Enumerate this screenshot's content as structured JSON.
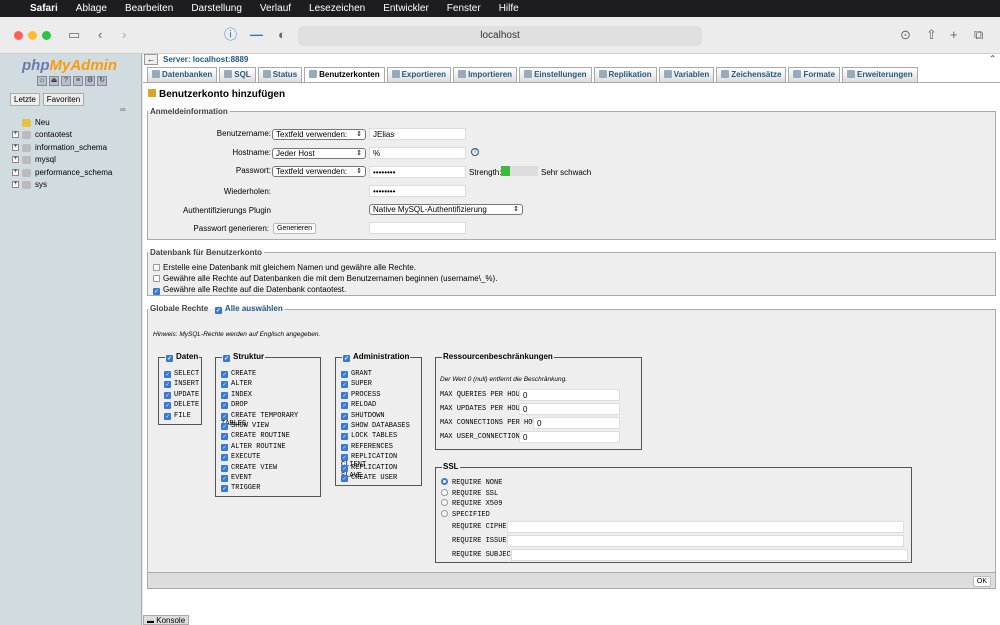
{
  "menubar": {
    "app": "Safari",
    "items": [
      "Ablage",
      "Bearbeiten",
      "Darstellung",
      "Verlauf",
      "Lesezeichen",
      "Entwickler",
      "Fenster",
      "Hilfe"
    ]
  },
  "browser": {
    "url": "localhost"
  },
  "sidebar": {
    "logo_php": "php",
    "logo_my": "MyAdmin",
    "tab_recent": "Letzte",
    "tab_favorites": "Favoriten",
    "tree": [
      "Neu",
      "contaotest",
      "information_schema",
      "mysql",
      "performance_schema",
      "sys"
    ]
  },
  "server": "Server: localhost:8889",
  "tabs": [
    "Datenbanken",
    "SQL",
    "Status",
    "Benutzerkonten",
    "Exportieren",
    "Importieren",
    "Einstellungen",
    "Replikation",
    "Variablen",
    "Zeichensätze",
    "Formate",
    "Erweiterungen"
  ],
  "page_title": "Benutzerkonto hinzufügen",
  "login": {
    "legend": "Anmeldeinformation",
    "username_label": "Benutzername:",
    "username_select": "Textfeld verwenden:",
    "username_value": "JElias",
    "host_label": "Hostname:",
    "host_select": "Jeder Host",
    "host_value": "%",
    "host_help": "?",
    "password_label": "Passwort:",
    "password_select": "Textfeld verwenden:",
    "password_value": "••••••••",
    "strength_label": "Strength:",
    "strength_text": "Sehr schwach",
    "strength_fraction": 0.25,
    "repeat_label": "Wiederholen:",
    "repeat_value": "••••••••",
    "plugin_label": "Authentifizierungs Plugin",
    "plugin_value": "Native MySQL-Authentifizierung",
    "generate_label": "Passwort generieren:",
    "generate_button": "Generieren"
  },
  "database": {
    "legend": "Datenbank für Benutzerkonto",
    "options": [
      {
        "label": "Erstelle eine Datenbank mit gleichem Namen und gewähre alle Rechte.",
        "checked": false
      },
      {
        "label": "Gewähre alle Rechte auf Datenbanken die mit dem Benutzernamen beginnen (username\\_%).",
        "checked": false
      },
      {
        "label": "Gewähre alle Rechte auf die Datenbank contaotest.",
        "checked": true
      }
    ]
  },
  "global": {
    "legend": "Globale Rechte",
    "select_all": "Alle auswählen",
    "hint": "Hinweis: MySQL-Rechte werden auf Englisch angegeben.",
    "daten": {
      "title": "Daten",
      "items": [
        "SELECT",
        "INSERT",
        "UPDATE",
        "DELETE",
        "FILE"
      ]
    },
    "struktur": {
      "title": "Struktur",
      "items": [
        "CREATE",
        "ALTER",
        "INDEX",
        "DROP",
        "CREATE TEMPORARY TABLES",
        "SHOW VIEW",
        "CREATE ROUTINE",
        "ALTER ROUTINE",
        "EXECUTE",
        "CREATE VIEW",
        "EVENT",
        "TRIGGER"
      ]
    },
    "admin": {
      "title": "Administration",
      "items": [
        "GRANT",
        "SUPER",
        "PROCESS",
        "RELOAD",
        "SHUTDOWN",
        "SHOW DATABASES",
        "LOCK TABLES",
        "REFERENCES",
        "REPLICATION CLIENT",
        "REPLICATION SLAVE",
        "CREATE USER"
      ]
    },
    "resources": {
      "title": "Ressourcenbeschränkungen",
      "note": "Der Wert 0 (null) entfernt die Beschränkung.",
      "rows": [
        {
          "label": "MAX QUERIES PER HOUR",
          "value": "0"
        },
        {
          "label": "MAX UPDATES PER HOUR",
          "value": "0"
        },
        {
          "label": "MAX CONNECTIONS PER HOUR",
          "value": "0"
        },
        {
          "label": "MAX USER_CONNECTIONS",
          "value": "0"
        }
      ]
    },
    "ssl": {
      "title": "SSL",
      "options": [
        {
          "label": "REQUIRE NONE",
          "selected": true
        },
        {
          "label": "REQUIRE SSL",
          "selected": false
        },
        {
          "label": "REQUIRE X509",
          "selected": false
        },
        {
          "label": "SPECIFIED",
          "selected": false
        }
      ],
      "fields": [
        "REQUIRE CIPHER",
        "REQUIRE ISSUER",
        "REQUIRE SUBJECT"
      ]
    }
  },
  "ok_button": "OK",
  "console": "Konsole"
}
